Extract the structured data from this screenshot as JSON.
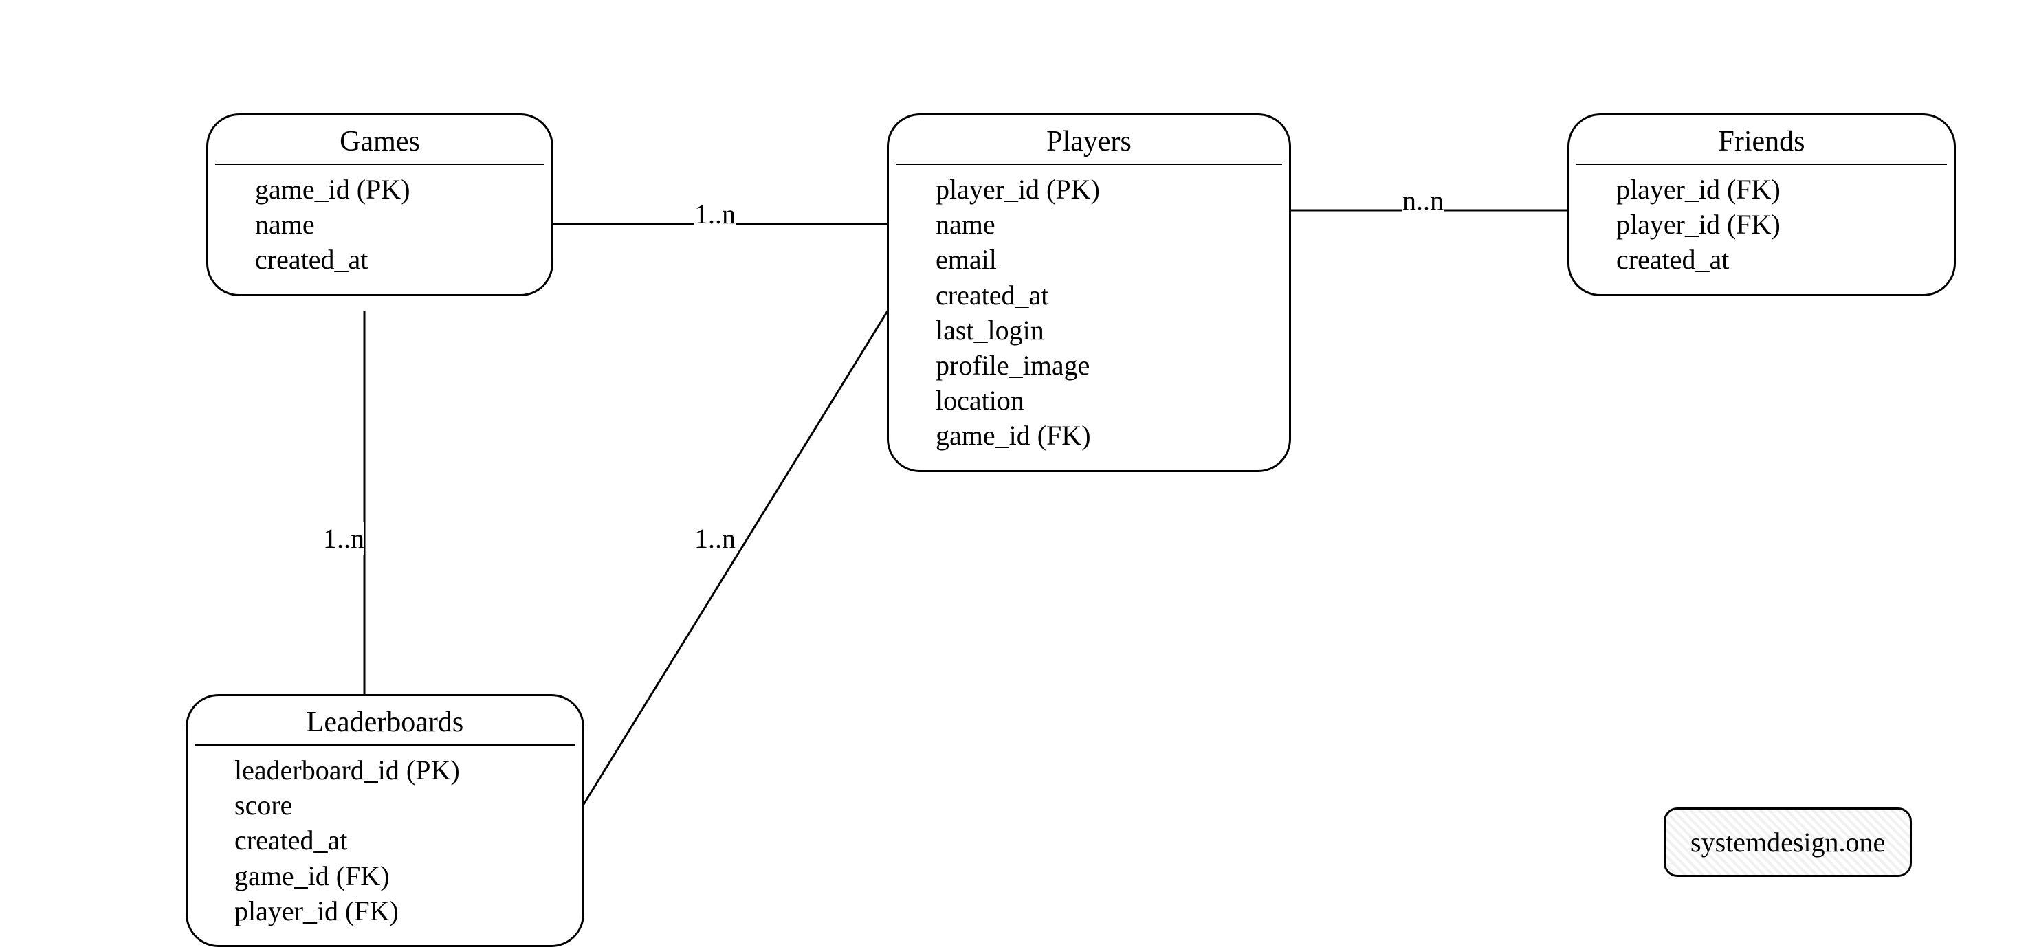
{
  "entities": {
    "games": {
      "title": "Games",
      "fields": [
        "game_id (PK)",
        "name",
        "created_at"
      ]
    },
    "players": {
      "title": "Players",
      "fields": [
        "player_id (PK)",
        "name",
        "email",
        "created_at",
        "last_login",
        "profile_image",
        "location",
        "game_id (FK)"
      ]
    },
    "friends": {
      "title": "Friends",
      "fields": [
        "player_id (FK)",
        "player_id (FK)",
        "created_at"
      ]
    },
    "leaderboards": {
      "title": "Leaderboards",
      "fields": [
        "leaderboard_id (PK)",
        "score",
        "created_at",
        "game_id (FK)",
        "player_id (FK)"
      ]
    }
  },
  "relationships": {
    "games_players": "1..n",
    "games_leaderboards": "1..n",
    "players_leaderboards": "1..n",
    "players_friends": "n..n"
  },
  "watermark": "systemdesign.one"
}
